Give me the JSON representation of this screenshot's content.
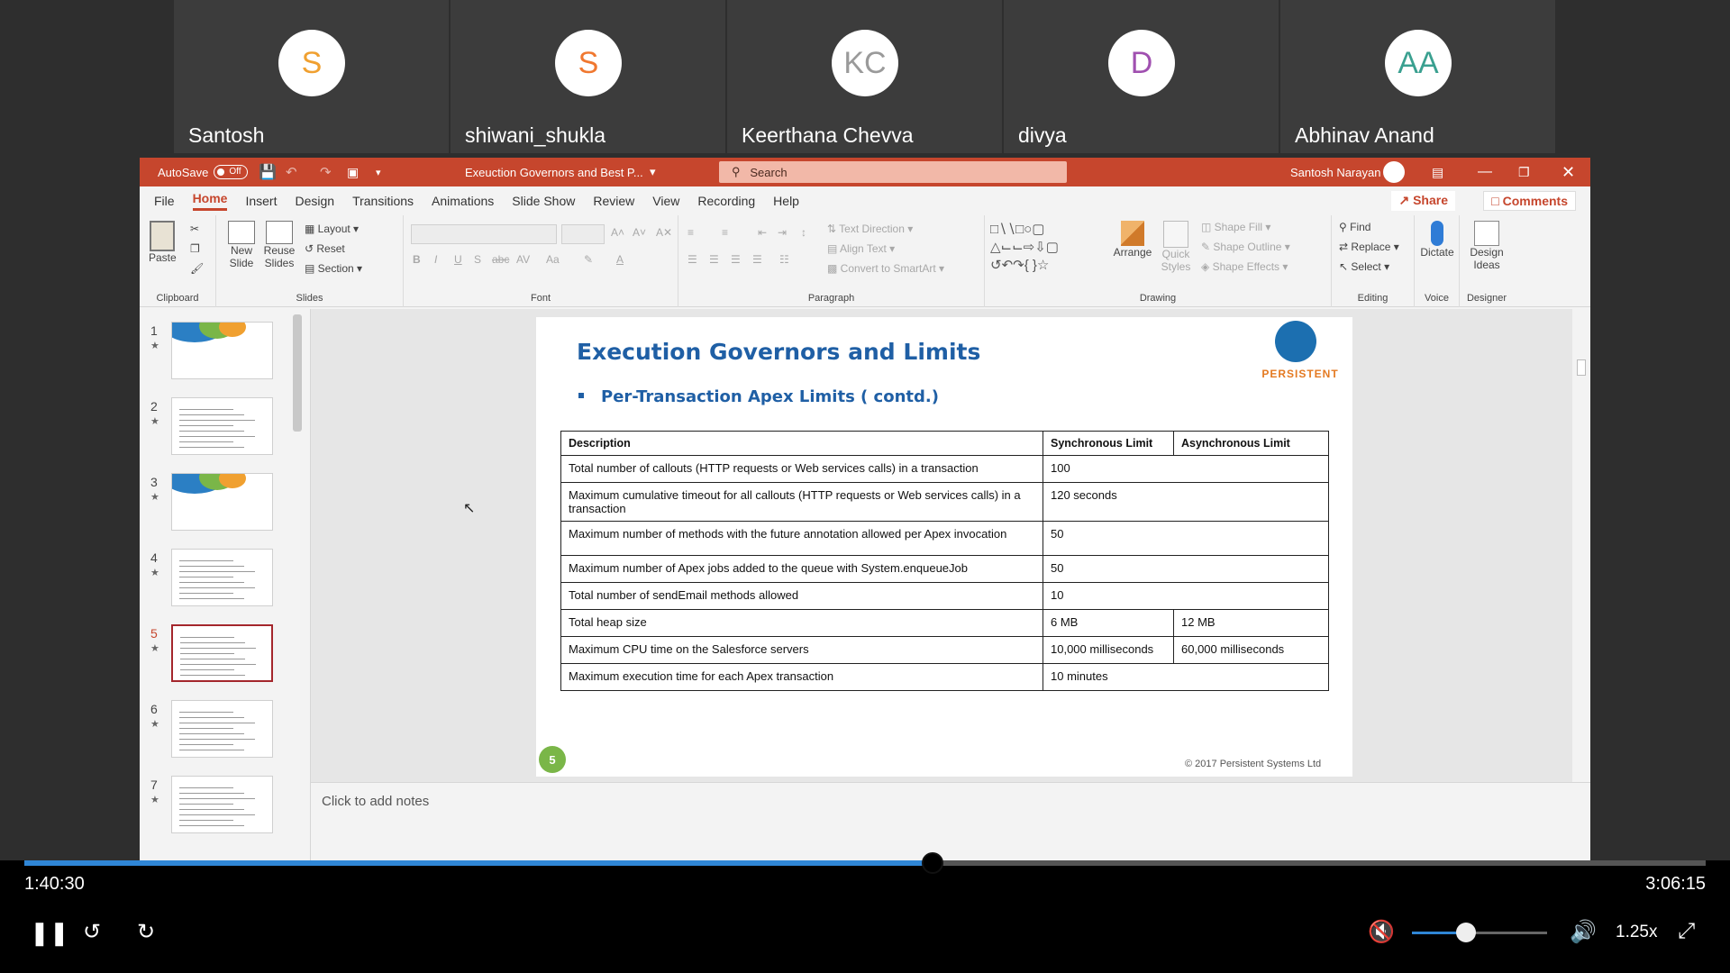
{
  "participants": [
    {
      "initials": "S",
      "name": "Santosh",
      "color": "#f0a030"
    },
    {
      "initials": "S",
      "name": "shiwani_shukla",
      "color": "#f07830"
    },
    {
      "initials": "KC",
      "name": "Keerthana Chevva",
      "color": "#9a9a9a"
    },
    {
      "initials": "D",
      "name": "divya",
      "color": "#a050b0"
    },
    {
      "initials": "AA",
      "name": "Abhinav Anand",
      "color": "#3aa090"
    }
  ],
  "ppt": {
    "autosave_label": "AutoSave",
    "autosave_state": "Off",
    "doc_title": "Exeuction Governors and Best P...",
    "search_placeholder": "Search",
    "user_name": "Santosh Narayan",
    "tabs": [
      "File",
      "Home",
      "Insert",
      "Design",
      "Transitions",
      "Animations",
      "Slide Show",
      "Review",
      "View",
      "Recording",
      "Help"
    ],
    "active_tab": "Home",
    "share_label": "Share",
    "comments_label": "Comments",
    "ribbon": {
      "clipboard": {
        "paste": "Paste",
        "label": "Clipboard"
      },
      "slides": {
        "new_slide": "New Slide",
        "reuse_slides": "Reuse Slides",
        "layout": "Layout",
        "reset": "Reset",
        "section": "Section",
        "label": "Slides"
      },
      "font": {
        "label": "Font"
      },
      "paragraph": {
        "text_direction": "Text Direction",
        "align_text": "Align Text",
        "convert_smartart": "Convert to SmartArt",
        "label": "Paragraph"
      },
      "drawing": {
        "arrange": "Arrange",
        "quick_styles": "Quick Styles",
        "shape_fill": "Shape Fill",
        "shape_outline": "Shape Outline",
        "shape_effects": "Shape Effects",
        "label": "Drawing"
      },
      "editing": {
        "find": "Find",
        "replace": "Replace",
        "select": "Select",
        "label": "Editing"
      },
      "voice": {
        "dictate": "Dictate",
        "label": "Voice"
      },
      "designer": {
        "design_ideas": "Design Ideas",
        "label": "Designer"
      }
    },
    "thumbnails": [
      {
        "num": "1"
      },
      {
        "num": "2"
      },
      {
        "num": "3"
      },
      {
        "num": "4"
      },
      {
        "num": "5",
        "active": true
      },
      {
        "num": "6"
      },
      {
        "num": "7"
      }
    ],
    "notes_placeholder": "Click to add notes",
    "slide": {
      "title": "Execution Governors and Limits",
      "subtitle": "Per-Transaction Apex Limits ( contd.)",
      "logo_text": "PERSISTENT",
      "table_headers": [
        "Description",
        "Synchronous Limit",
        "Asynchronous Limit"
      ],
      "rows": [
        {
          "desc": "Total number of callouts (HTTP requests or Web services calls) in a transaction",
          "sync": "100",
          "async": "",
          "merged": true
        },
        {
          "desc": "Maximum cumulative timeout for all callouts (HTTP requests or Web services calls) in a transaction",
          "sync": "120 seconds",
          "async": "",
          "merged": true
        },
        {
          "desc": "Maximum number of methods with the future annotation allowed per Apex invocation",
          "sync": "50",
          "async": "",
          "merged": true
        },
        {
          "desc": "Maximum number of Apex jobs added to the queue with System.enqueueJob",
          "sync": "50",
          "async": "",
          "merged": true
        },
        {
          "desc": "Total number of sendEmail methods allowed",
          "sync": "10",
          "async": "",
          "merged": true
        },
        {
          "desc": "Total heap size",
          "sync": "6 MB",
          "async": "12 MB",
          "merged": false
        },
        {
          "desc": "Maximum CPU time on the Salesforce servers",
          "sync": "10,000 milliseconds",
          "async": "60,000 milliseconds",
          "merged": false
        },
        {
          "desc": "Maximum execution time for each Apex transaction",
          "sync": "10 minutes",
          "async": "",
          "merged": true
        }
      ],
      "slide_number": "5",
      "copyright": "© 2017 Persistent Systems Ltd"
    }
  },
  "player": {
    "current_time": "1:40:30",
    "total_time": "3:06:15",
    "progress_fraction": 0.54,
    "volume_fraction": 0.4,
    "speed": "1.25x"
  }
}
